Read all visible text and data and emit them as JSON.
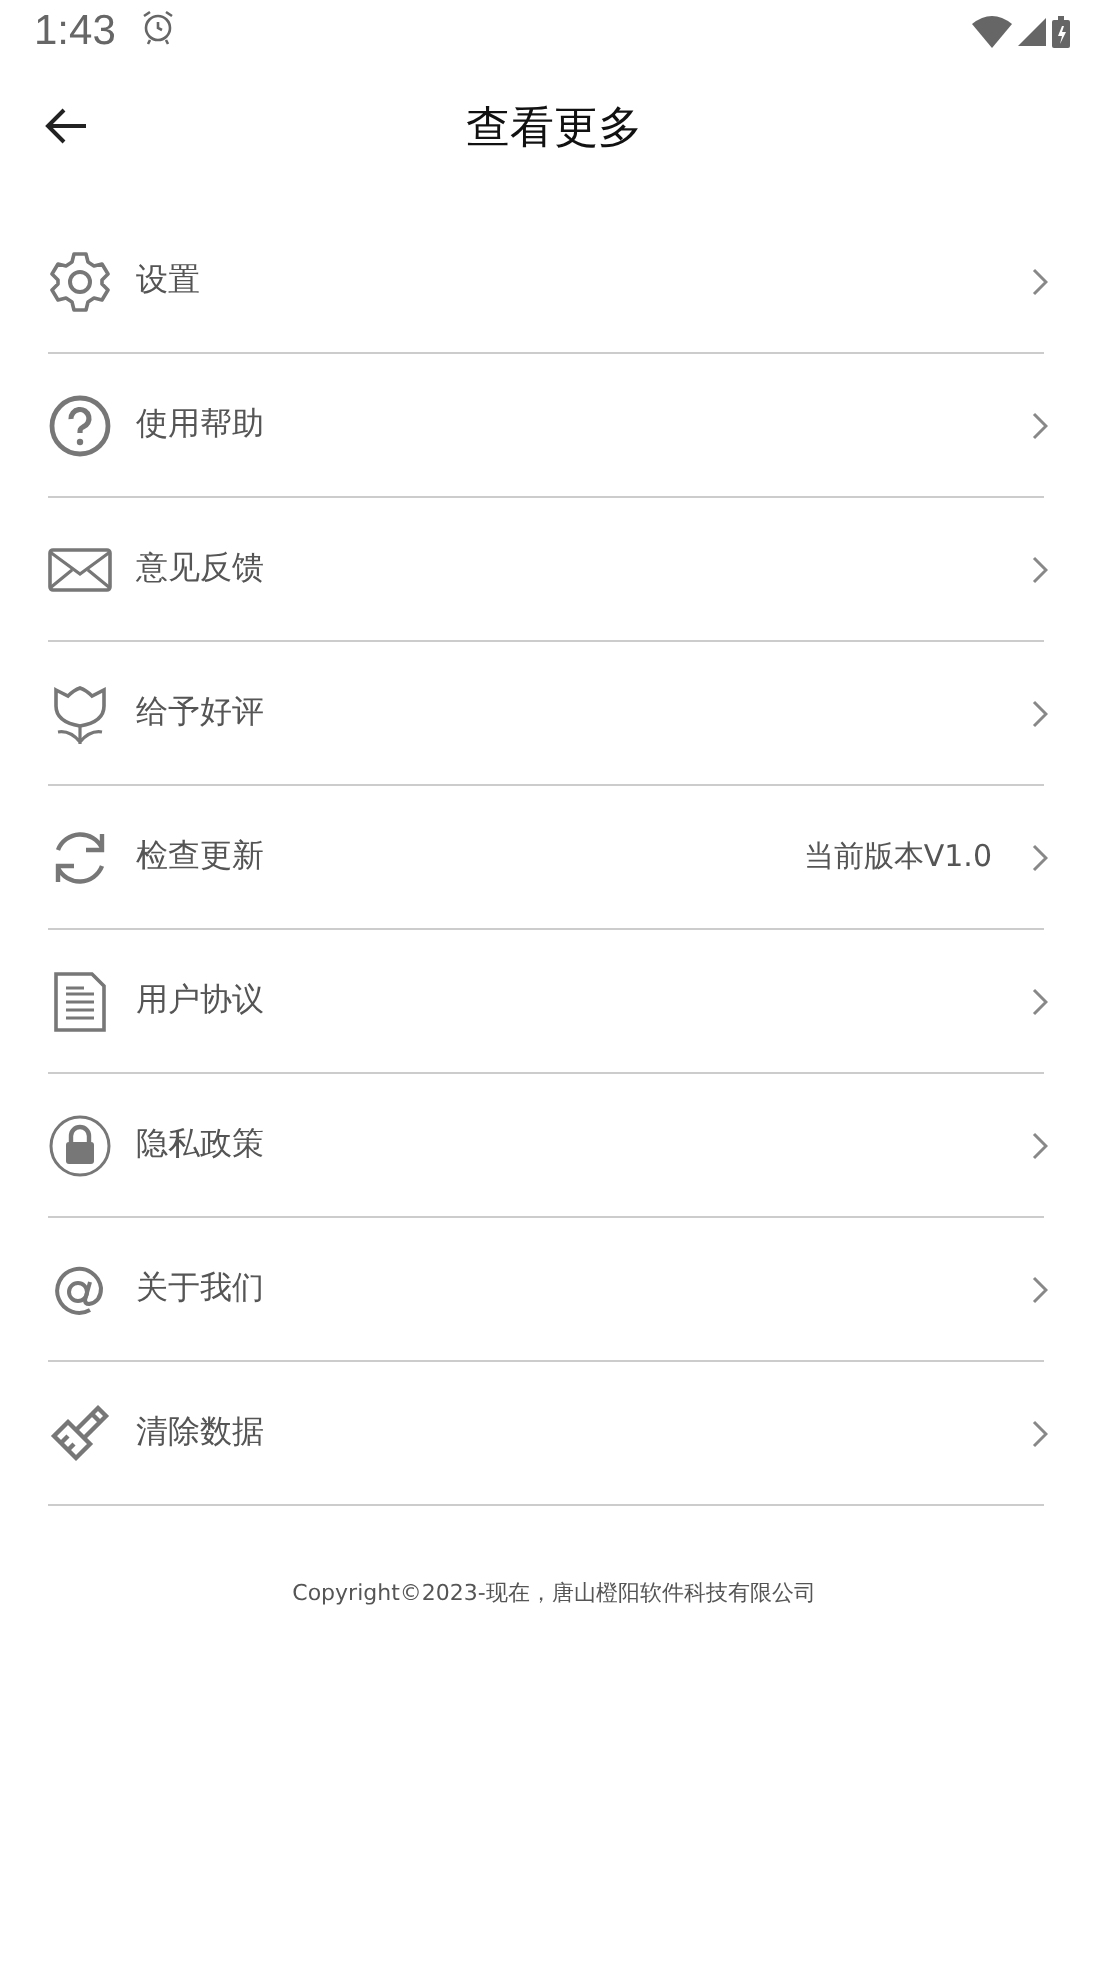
{
  "status_bar": {
    "time": "1:43"
  },
  "header": {
    "title": "查看更多"
  },
  "items": [
    {
      "kind": "settings",
      "label": "设置"
    },
    {
      "kind": "help",
      "label": "使用帮助"
    },
    {
      "kind": "feedback",
      "label": "意见反馈"
    },
    {
      "kind": "rate",
      "label": "给予好评"
    },
    {
      "kind": "update",
      "label": "检查更新",
      "value": "当前版本V1.0"
    },
    {
      "kind": "agreement",
      "label": "用户协议"
    },
    {
      "kind": "privacy",
      "label": "隐私政策"
    },
    {
      "kind": "about",
      "label": "关于我们"
    },
    {
      "kind": "clear",
      "label": "清除数据"
    }
  ],
  "footer": "Copyright©2023-现在，唐山橙阳软件科技有限公司"
}
